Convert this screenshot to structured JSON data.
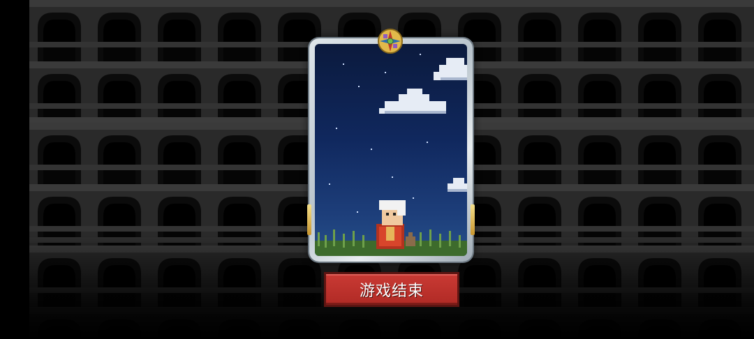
{
  "button": {
    "label": "游戏结束"
  },
  "colors": {
    "button_red": "#b02a25",
    "sky_top": "#0b1a3d",
    "sky_bottom": "#26508a",
    "card_frame": "#c9d2d8",
    "gold_trim": "#e2b94a"
  },
  "icons": {
    "emblem": "compass-emblem-icon",
    "character": "white-haired-hero-sprite"
  }
}
